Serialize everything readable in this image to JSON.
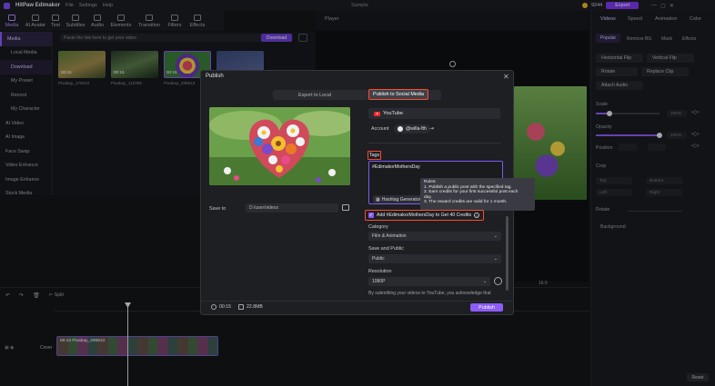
{
  "app": {
    "title": "HitPaw Edimakor",
    "menu": [
      "File",
      "Settings",
      "Help"
    ],
    "project_name": "Sample"
  },
  "toolbar": [
    {
      "label": "Media",
      "icon": "media-icon"
    },
    {
      "label": "AI Avatar",
      "icon": "avatar-icon"
    },
    {
      "label": "Text",
      "icon": "text-icon"
    },
    {
      "label": "Subtitles",
      "icon": "subtitles-icon"
    },
    {
      "label": "Audio",
      "icon": "audio-icon"
    },
    {
      "label": "Elements",
      "icon": "elements-icon"
    },
    {
      "label": "Transition",
      "icon": "transition-icon"
    },
    {
      "label": "Filters",
      "icon": "filters-icon"
    },
    {
      "label": "Effects",
      "icon": "effects-icon"
    }
  ],
  "sidebar": {
    "media": "Media",
    "local_media": "Local Media",
    "download": "Download",
    "my_preset": "My Preset",
    "record": "Record",
    "my_character": "My Character",
    "ai_video": "AI Video",
    "ai_image": "AI Image",
    "face_swap": "Face Swap",
    "video_enhance": "Video Enhance",
    "image_enhance": "Image Enhance",
    "stock_media": "Stock Media"
  },
  "media_panel": {
    "link_placeholder": "Paste the link here to get your video",
    "download_label": "Download",
    "thumbs": [
      {
        "duration": "00:15",
        "name": "Pixabay_175012"
      },
      {
        "duration": "00:15",
        "name": "Pixabay_112005"
      },
      {
        "duration": "00:15",
        "name": "Pixabay_208813"
      },
      {
        "duration": "",
        "name": ""
      }
    ]
  },
  "player": {
    "label": "Player"
  },
  "topright": {
    "credits": "9244",
    "export_label": "Export"
  },
  "right_panel": {
    "tabs": [
      "Videos",
      "Speed",
      "Animation",
      "Color"
    ],
    "subtabs": [
      "Popular",
      "Remove BG",
      "Mask",
      "Effects"
    ],
    "buttons": [
      "Horizontal Flip",
      "Vertical Flip",
      "Rotate",
      "Replace Clip",
      "Attach Audio"
    ],
    "scale_label": "Scale",
    "scale_value": "100%",
    "opacity_label": "Opacity",
    "opacity_value": "100%",
    "position_label": "Position",
    "crop_label": "Crop",
    "crop_fields": [
      "Top",
      "Bottom",
      "Left",
      "Right"
    ],
    "crop_value": "0%",
    "rotate_label": "Rotate",
    "background_label": "Background",
    "reset_label": "Reset"
  },
  "timeline": {
    "split_label": "Split",
    "track_label": "Cover",
    "clip_label": "00:15 Pixabay_208813",
    "ratio": "16:9"
  },
  "dialog": {
    "title": "Publish",
    "tab_local": "Export to Local",
    "tab_social": "Publish to Social Media",
    "save_to_label": "Save to",
    "save_to_path": "D:/user/videos",
    "platform": "YouTube",
    "account_label": "Account",
    "account_name": "@willa-fth",
    "tags_label": "Tags",
    "tags_value": "#EdimakorMothersDay",
    "hashtag_btn": "Hashtag Generator",
    "tooltip_lines": [
      "Rules:",
      "1. Publish a public post with the specified tag.",
      "2. Earn credits for your first successful post each",
      "day.",
      "3. The reward credits are valid for 1 month."
    ],
    "credit_text": "Add #EdimakorMothersDay to Get 40 Credits",
    "category_label": "Category",
    "category_value": "Film & Animation",
    "save_public_label": "Save and Public",
    "save_public_value": "Public",
    "resolution_label": "Resolution",
    "resolution_value": "1080P",
    "disclaimer": "By submitting your videos to YouTube, you acknowledge that",
    "duration": "00:15",
    "filesize": "22.8MB",
    "publish_label": "Publish"
  }
}
